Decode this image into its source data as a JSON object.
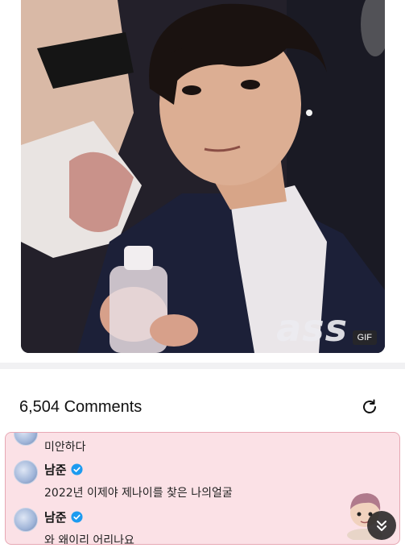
{
  "post": {
    "gif_watermark": "ass",
    "gif_badge": "GIF"
  },
  "comments": {
    "count_label": "6,504 Comments",
    "items": [
      {
        "text": "미안하다"
      },
      {
        "author": "남준",
        "verified": true,
        "text": "2022년 이제야 제나이를 찾은 나의얼굴"
      },
      {
        "author": "남준",
        "verified": true,
        "text": "와 왜이리 어리나요"
      }
    ]
  },
  "colors": {
    "highlight_bg": "#fbe1e6",
    "highlight_border": "#e7a8b4",
    "verified_blue": "#1d9bf0"
  },
  "icons": {
    "refresh": "refresh-icon",
    "verified": "verified-badge-icon",
    "scroll_down": "double-chevron-down-icon"
  }
}
